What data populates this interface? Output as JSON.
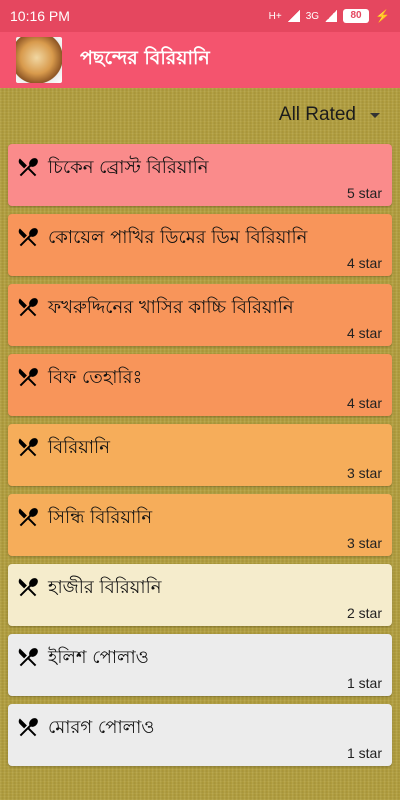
{
  "status_bar": {
    "time": "10:16 PM",
    "net1": "H+",
    "net2": "3G",
    "battery": "80"
  },
  "app_bar": {
    "title": "পছন্দের বিরিয়ানি"
  },
  "filter": {
    "selected": "All Rated"
  },
  "items": [
    {
      "name": "চিকেন ব্রোস্ট বিরিয়ানি",
      "rating": "5 star",
      "color": "#fa8b8b"
    },
    {
      "name": "কোয়েল পাখির ডিমের ডিম বিরিয়ানি",
      "rating": "4 star",
      "color": "#f8955a"
    },
    {
      "name": "ফখরুদ্দিনের খাসির কাচ্চি বিরিয়ানি",
      "rating": "4 star",
      "color": "#f8955a"
    },
    {
      "name": "বিফ তেহারিঃ",
      "rating": "4 star",
      "color": "#f8955a"
    },
    {
      "name": "বিরিয়ানি",
      "rating": "3 star",
      "color": "#f6ad5a"
    },
    {
      "name": "সিন্ধি বিরিয়ানি",
      "rating": "3 star",
      "color": "#f6ad5a"
    },
    {
      "name": "হাজীর বিরিয়ানি",
      "rating": "2 star",
      "color": "#f5eccc"
    },
    {
      "name": "ইলিশ পোলাও",
      "rating": "1 star",
      "color": "#ececec"
    },
    {
      "name": "মোরগ পোলাও",
      "rating": "1 star",
      "color": "#ececec"
    }
  ]
}
